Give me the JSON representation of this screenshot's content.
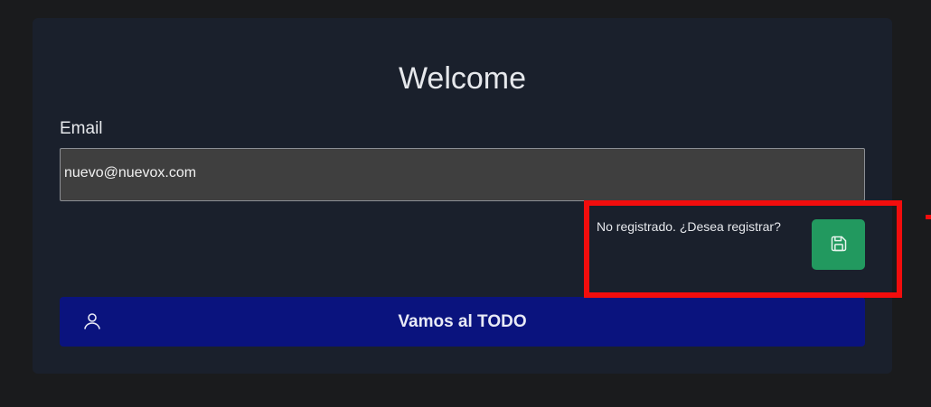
{
  "login": {
    "title": "Welcome",
    "email_label": "Email",
    "email_value": "nuevo@nuevox.com",
    "register_prompt": "No registrado. ¿Desea registrar?",
    "register_icon": "save-icon",
    "go_label": "Vamos al TODO",
    "go_icon": "user-icon"
  },
  "colors": {
    "page_background": "#1a1b1d",
    "card_background": "#1a202c",
    "input_background": "#3f3f3f",
    "register_button": "#22995f",
    "primary_button": "#0a137e",
    "highlight": "#f20d0d"
  }
}
